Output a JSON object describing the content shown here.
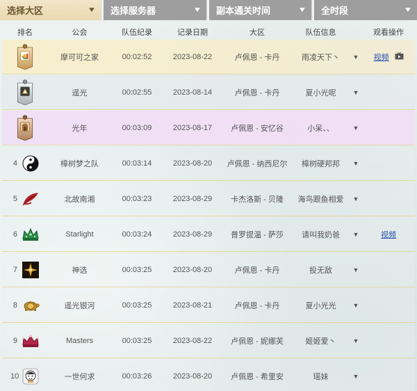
{
  "filters": [
    {
      "label": "选择大区",
      "active": true
    },
    {
      "label": "选择服务器",
      "active": false
    },
    {
      "label": "副本通关时间",
      "active": false
    },
    {
      "label": "全时段",
      "active": false
    }
  ],
  "columns": {
    "rank": "排名",
    "guild": "公会",
    "time": "队伍纪录",
    "date": "记录日期",
    "region": "大区",
    "info": "队伍信息",
    "watch": "观看操作"
  },
  "rows": [
    {
      "rank": "1",
      "guild": "摩可可之家",
      "time": "00:02:52",
      "date": "2023-08-22",
      "region": "卢佩恩 - 卡丹",
      "info": "雨凌天下丶",
      "video": "视频",
      "emblem": "gold-medal-badge-icon"
    },
    {
      "rank": "2",
      "guild": "遥光",
      "time": "00:02:55",
      "date": "2023-08-14",
      "region": "卢佩恩 - 卡丹",
      "info": "夏小光呢",
      "video": "",
      "emblem": "silver-medal-badge-icon"
    },
    {
      "rank": "3",
      "guild": "光年",
      "time": "00:03:09",
      "date": "2023-08-17",
      "region": "卢佩恩 - 安忆谷",
      "info": "小呆、、",
      "video": "",
      "emblem": "bronze-medal-badge-icon"
    },
    {
      "rank": "4",
      "guild": "樟树梦之队",
      "time": "00:03:14",
      "date": "2023-08-20",
      "region": "卢佩恩 - 纳西尼尔",
      "info": "樟树硬邦邦",
      "video": "",
      "emblem": "yin-yang-icon"
    },
    {
      "rank": "5",
      "guild": "北故南湘",
      "time": "00:03:23",
      "date": "2023-08-29",
      "region": "卡杰洛斯 - 贝隆",
      "info": "海鸟跟鱼相爱",
      "video": "",
      "emblem": "red-leaf-icon"
    },
    {
      "rank": "6",
      "guild": "Starlight",
      "time": "00:03:24",
      "date": "2023-08-29",
      "region": "普罗提温 - 萨莎",
      "info": "请叫我奶爸",
      "video": "视频",
      "emblem": "green-crown-icon"
    },
    {
      "rank": "7",
      "guild": "神选",
      "time": "00:03:25",
      "date": "2023-08-20",
      "region": "卢佩恩 - 卡丹",
      "info": "投无敌",
      "video": "",
      "emblem": "golden-star-icon"
    },
    {
      "rank": "8",
      "guild": "遥光银河",
      "time": "00:03:25",
      "date": "2023-08-21",
      "region": "卢佩恩 - 卡丹",
      "info": "夏小光光",
      "video": "",
      "emblem": "golden-turtle-icon"
    },
    {
      "rank": "9",
      "guild": "Masters",
      "time": "00:03:25",
      "date": "2023-08-22",
      "region": "卢佩恩 - 妮娜芙",
      "info": "姬姬爱丶",
      "video": "",
      "emblem": "red-crown-icon"
    },
    {
      "rank": "10",
      "guild": "一世何求",
      "time": "00:03:26",
      "date": "2023-08-20",
      "region": "卢佩恩 - 希里安",
      "info": "瑶妹",
      "video": "",
      "emblem": "cartoon-face-icon"
    }
  ]
}
